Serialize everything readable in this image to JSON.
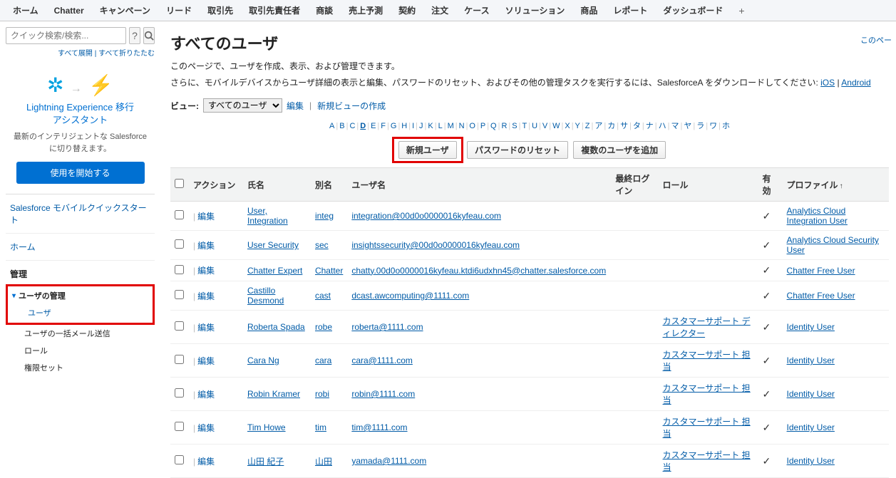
{
  "topnav": [
    "ホーム",
    "Chatter",
    "キャンペーン",
    "リード",
    "取引先",
    "取引先責任者",
    "商談",
    "売上予測",
    "契約",
    "注文",
    "ケース",
    "ソリューション",
    "商品",
    "レポート",
    "ダッシュボード"
  ],
  "search": {
    "placeholder": "クイック検索/検索...",
    "expand": "すべて展開",
    "collapse": "すべて折りたたむ"
  },
  "lex": {
    "title1": "Lightning Experience 移行",
    "title2": "アシスタント",
    "desc": "最新のインテリジェントな Salesforce に切り替えます。",
    "btn": "使用を開始する"
  },
  "side": {
    "quickstart": "Salesforce モバイルクイックスタート",
    "home": "ホーム",
    "manage": "管理"
  },
  "tree": {
    "parent": "ユーザの管理",
    "items": [
      "ユーザ",
      "ユーザの一括メール送信",
      "ロール",
      "権限セット"
    ]
  },
  "page": {
    "title": "すべてのユーザ",
    "rightlink": "このペー",
    "desc1": "このページで、ユーザを作成、表示、および管理できます。",
    "desc2a": "さらに、モバイルデバイスからユーザ詳細の表示と編集、パスワードのリセット、およびその他の管理タスクを実行するには、SalesforceA をダウンロードしてください: ",
    "ios": "iOS",
    "android": "Android"
  },
  "view": {
    "label": "ビュー:",
    "selected": "すべてのユーザ",
    "edit": "編集",
    "create": "新規ビューの作成"
  },
  "alpha": [
    "A",
    "B",
    "C",
    "D",
    "E",
    "F",
    "G",
    "H",
    "I",
    "J",
    "K",
    "L",
    "M",
    "N",
    "O",
    "P",
    "Q",
    "R",
    "S",
    "T",
    "U",
    "V",
    "W",
    "X",
    "Y",
    "Z",
    "ア",
    "カ",
    "サ",
    "タ",
    "ナ",
    "ハ",
    "マ",
    "ヤ",
    "ラ",
    "ワ",
    "ホ"
  ],
  "alpha_selected": "D",
  "buttons": {
    "new": "新規ユーザ",
    "reset": "パスワードのリセット",
    "addmulti": "複数のユーザを追加"
  },
  "cols": {
    "action": "アクション",
    "name": "氏名",
    "alias": "別名",
    "username": "ユーザ名",
    "lastlogin": "最終ログイン",
    "role": "ロール",
    "active": "有効",
    "profile": "プロファイル"
  },
  "edit_label": "編集",
  "rows": [
    {
      "name": "User, Integration",
      "alias": "integ",
      "username": "integration@00d0o0000016kyfeau.com",
      "lastlogin": "",
      "role": "",
      "active": true,
      "profile": "Analytics Cloud Integration User"
    },
    {
      "name": "User Security",
      "alias": "sec",
      "username": "insightssecurity@00d0o0000016kyfeau.com",
      "lastlogin": "",
      "role": "",
      "active": true,
      "profile": "Analytics Cloud Security User"
    },
    {
      "name": "Chatter Expert",
      "alias": "Chatter",
      "username": "chatty.00d0o0000016kyfeau.ktdi6udxhn45@chatter.salesforce.com",
      "lastlogin": "",
      "role": "",
      "active": true,
      "profile": "Chatter Free User"
    },
    {
      "name": "Castillo Desmond",
      "alias": "cast",
      "username": "dcast.awcomputing@1111.com",
      "lastlogin": "",
      "role": "",
      "active": true,
      "profile": "Chatter Free User"
    },
    {
      "name": "Roberta Spada",
      "alias": "robe",
      "username": "roberta@1111.com",
      "lastlogin": "",
      "role": "カスタマーサポート ディレクター",
      "active": true,
      "profile": "Identity User"
    },
    {
      "name": "Cara Ng",
      "alias": "cara",
      "username": "cara@1111.com",
      "lastlogin": "",
      "role": "カスタマーサポート 担当",
      "active": true,
      "profile": "Identity User"
    },
    {
      "name": "Robin Kramer",
      "alias": "robi",
      "username": "robin@1111.com",
      "lastlogin": "",
      "role": "カスタマーサポート 担当",
      "active": true,
      "profile": "Identity User"
    },
    {
      "name": "Tim Howe",
      "alias": "tim",
      "username": "tim@1111.com",
      "lastlogin": "",
      "role": "カスタマーサポート 担当",
      "active": true,
      "profile": "Identity User"
    },
    {
      "name": "山田 紀子",
      "alias": "山田",
      "username": "yamada@1111.com",
      "lastlogin": "",
      "role": "カスタマーサポート 担当",
      "active": true,
      "profile": "Identity User"
    }
  ]
}
